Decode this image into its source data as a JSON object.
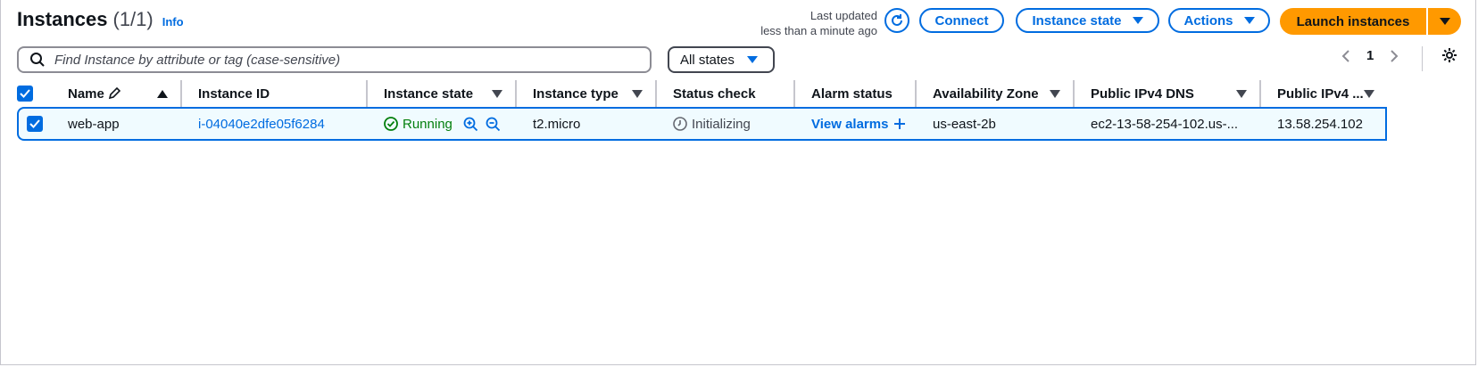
{
  "header": {
    "title": "Instances",
    "count": "(1/1)",
    "info_link": "Info",
    "last_updated_line1": "Last updated",
    "last_updated_line2": "less than a minute ago"
  },
  "toolbar": {
    "connect_label": "Connect",
    "instance_state_label": "Instance state",
    "actions_label": "Actions",
    "launch_label": "Launch instances"
  },
  "search": {
    "placeholder": "Find Instance by attribute or tag (case-sensitive)"
  },
  "filter": {
    "selected": "All states"
  },
  "pagination": {
    "page": "1"
  },
  "table": {
    "columns": [
      {
        "label": "Name",
        "sort": "asc",
        "editable": true
      },
      {
        "label": "Instance ID"
      },
      {
        "label": "Instance state"
      },
      {
        "label": "Instance type"
      },
      {
        "label": "Status check"
      },
      {
        "label": "Alarm status"
      },
      {
        "label": "Availability Zone"
      },
      {
        "label": "Public IPv4 DNS"
      },
      {
        "label": "Public IPv4 ..."
      }
    ],
    "rows": [
      {
        "name": "web-app",
        "instance_id": "i-04040e2dfe05f6284",
        "state": "Running",
        "type": "t2.micro",
        "status_check": "Initializing",
        "alarm_status": "View alarms",
        "az": "us-east-2b",
        "dns": "ec2-13-58-254-102.us-...",
        "ipv4": "13.58.254.102"
      }
    ]
  },
  "colors": {
    "accent": "#006ce0",
    "launch": "#ff9900",
    "running": "#037f0c"
  }
}
